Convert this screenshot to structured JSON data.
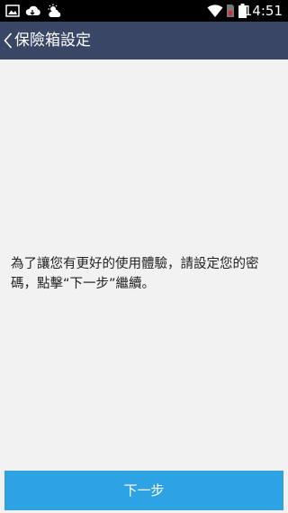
{
  "status_bar": {
    "time": "14:51",
    "icons": [
      "image-icon",
      "cloud-icon",
      "weather-icon",
      "wifi-icon",
      "no-sim-icon",
      "battery-icon"
    ]
  },
  "header": {
    "back_icon": "chevron-left-icon",
    "title": "保險箱設定"
  },
  "main": {
    "message": "為了讓您有更好的使用體驗，請設定您的密碼，點擊“下一步”繼續。"
  },
  "footer": {
    "next_label": "下一步"
  },
  "colors": {
    "header_bg": "#3a4666",
    "button_bg": "#2ea3e3",
    "content_bg": "#f2f2f2",
    "status_bar_bg": "#000000"
  }
}
